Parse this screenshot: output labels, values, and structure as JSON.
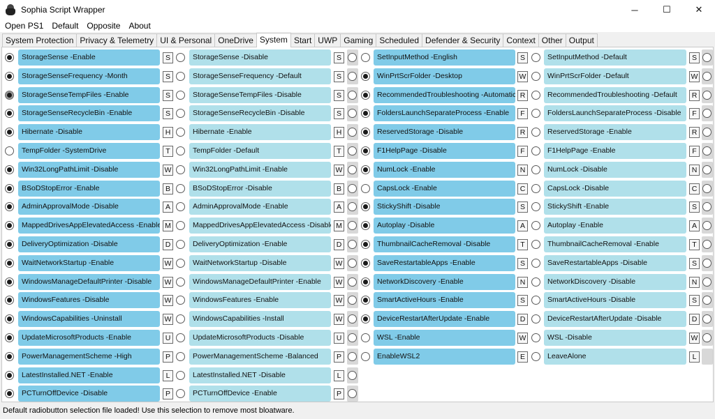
{
  "window": {
    "title": "Sophia Script Wrapper",
    "minimize": "─",
    "maximize": "☐",
    "close": "✕"
  },
  "menu": [
    "Open PS1",
    "Default",
    "Opposite",
    "About"
  ],
  "tabs": [
    "System Protection",
    "Privacy & Telemetry",
    "UI & Personal",
    "OneDrive",
    "System",
    "Start",
    "UWP",
    "Gaming",
    "Scheduled",
    "Defender & Security",
    "Context",
    "Other",
    "Output"
  ],
  "active_tab": "System",
  "colors": {
    "label_selected": "#80cbe8",
    "label_unselected": "#b0e0ea"
  },
  "groups": [
    {
      "rows": [
        {
          "a": "StorageSense -Enable",
          "b": "StorageSense -Disable",
          "key_a": "S",
          "key_b": "S",
          "sel": "a"
        },
        {
          "a": "StorageSenseFrequency -Month",
          "b": "StorageSenseFrequency -Default",
          "key_a": "S",
          "key_b": "S",
          "sel": "a"
        },
        {
          "a": "StorageSenseTempFiles -Enable",
          "b": "StorageSenseTempFiles -Disable",
          "key_a": "S",
          "key_b": "S",
          "sel": "a",
          "gray": true
        },
        {
          "a": "StorageSenseRecycleBin -Enable",
          "b": "StorageSenseRecycleBin -Disable",
          "key_a": "S",
          "key_b": "S",
          "sel": "a"
        },
        {
          "a": "Hibernate -Disable",
          "b": "Hibernate -Enable",
          "key_a": "H",
          "key_b": "H",
          "sel": "a"
        },
        {
          "a": "TempFolder -SystemDrive",
          "b": "TempFolder -Default",
          "key_a": "T",
          "key_b": "T",
          "sel": "none"
        },
        {
          "a": "Win32LongPathLimit -Disable",
          "b": "Win32LongPathLimit -Enable",
          "key_a": "W",
          "key_b": "W",
          "sel": "a"
        },
        {
          "a": "BSoDStopError -Enable",
          "b": "BSoDStopError -Disable",
          "key_a": "B",
          "key_b": "B",
          "sel": "a"
        },
        {
          "a": "AdminApprovalMode -Disable",
          "b": "AdminApprovalMode -Enable",
          "key_a": "A",
          "key_b": "A",
          "sel": "a"
        },
        {
          "a": "MappedDrivesAppElevatedAccess -Enable",
          "b": "MappedDrivesAppElevatedAccess -Disable",
          "key_a": "M",
          "key_b": "M",
          "sel": "a"
        },
        {
          "a": "DeliveryOptimization -Disable",
          "b": "DeliveryOptimization -Enable",
          "key_a": "D",
          "key_b": "D",
          "sel": "a"
        },
        {
          "a": "WaitNetworkStartup -Enable",
          "b": "WaitNetworkStartup -Disable",
          "key_a": "W",
          "key_b": "W",
          "sel": "a"
        },
        {
          "a": "WindowsManageDefaultPrinter -Disable",
          "b": "WindowsManageDefaultPrinter -Enable",
          "key_a": "W",
          "key_b": "W",
          "sel": "a"
        },
        {
          "a": "WindowsFeatures -Disable",
          "b": "WindowsFeatures -Enable",
          "key_a": "W",
          "key_b": "W",
          "sel": "a"
        },
        {
          "a": "WindowsCapabilities -Uninstall",
          "b": "WindowsCapabilities -Install",
          "key_a": "W",
          "key_b": "W",
          "sel": "a"
        },
        {
          "a": "UpdateMicrosoftProducts -Enable",
          "b": "UpdateMicrosoftProducts -Disable",
          "key_a": "U",
          "key_b": "U",
          "sel": "a"
        },
        {
          "a": "PowerManagementScheme -High",
          "b": "PowerManagementScheme -Balanced",
          "key_a": "P",
          "key_b": "P",
          "sel": "a"
        },
        {
          "a": "LatestInstalled.NET -Enable",
          "b": "LatestInstalled.NET -Disable",
          "key_a": "L",
          "key_b": "L",
          "sel": "a"
        },
        {
          "a": "PCTurnOffDevice -Disable",
          "b": "PCTurnOffDevice -Enable",
          "key_a": "P",
          "key_b": "P",
          "sel": "a"
        }
      ]
    },
    {
      "rows": [
        {
          "a": "SetInputMethod -English",
          "b": "SetInputMethod -Default",
          "key_a": "S",
          "key_b": "S",
          "sel": "none"
        },
        {
          "a": "WinPrtScrFolder -Desktop",
          "b": "WinPrtScrFolder -Default",
          "key_a": "W",
          "key_b": "W",
          "sel": "a"
        },
        {
          "a": "RecommendedTroubleshooting -Automatic",
          "b": "RecommendedTroubleshooting -Default",
          "key_a": "R",
          "key_b": "R",
          "sel": "a"
        },
        {
          "a": "FoldersLaunchSeparateProcess -Enable",
          "b": "FoldersLaunchSeparateProcess -Disable",
          "key_a": "F",
          "key_b": "F",
          "sel": "a"
        },
        {
          "a": "ReservedStorage -Disable",
          "b": "ReservedStorage -Enable",
          "key_a": "R",
          "key_b": "R",
          "sel": "a"
        },
        {
          "a": "F1HelpPage -Disable",
          "b": "F1HelpPage -Enable",
          "key_a": "F",
          "key_b": "F",
          "sel": "a"
        },
        {
          "a": "NumLock -Enable",
          "b": "NumLock -Disable",
          "key_a": "N",
          "key_b": "N",
          "sel": "a"
        },
        {
          "a": "CapsLock -Enable",
          "b": "CapsLock -Disable",
          "key_a": "C",
          "key_b": "C",
          "sel": "none"
        },
        {
          "a": "StickyShift -Disable",
          "b": "StickyShift -Enable",
          "key_a": "S",
          "key_b": "S",
          "sel": "a"
        },
        {
          "a": "Autoplay -Disable",
          "b": "Autoplay -Enable",
          "key_a": "A",
          "key_b": "A",
          "sel": "a"
        },
        {
          "a": "ThumbnailCacheRemoval -Disable",
          "b": "ThumbnailCacheRemoval -Enable",
          "key_a": "T",
          "key_b": "T",
          "sel": "a"
        },
        {
          "a": "SaveRestartableApps -Enable",
          "b": "SaveRestartableApps -Disable",
          "key_a": "S",
          "key_b": "S",
          "sel": "a"
        },
        {
          "a": "NetworkDiscovery -Enable",
          "b": "NetworkDiscovery -Disable",
          "key_a": "N",
          "key_b": "N",
          "sel": "a"
        },
        {
          "a": "SmartActiveHours -Enable",
          "b": "SmartActiveHours -Disable",
          "key_a": "S",
          "key_b": "S",
          "sel": "a"
        },
        {
          "a": "DeviceRestartAfterUpdate -Enable",
          "b": "DeviceRestartAfterUpdate -Disable",
          "key_a": "D",
          "key_b": "D",
          "sel": "a"
        },
        {
          "a": "WSL -Enable",
          "b": "WSL -Disable",
          "key_a": "W",
          "key_b": "W",
          "sel": "none"
        },
        {
          "a": "EnableWSL2",
          "b": "LeaveAlone",
          "key_a": "E",
          "key_b": "L",
          "sel": "none",
          "no_right_radio": true
        }
      ]
    }
  ],
  "status": "Default radiobutton selection file loaded! Use this selection to remove most bloatware."
}
